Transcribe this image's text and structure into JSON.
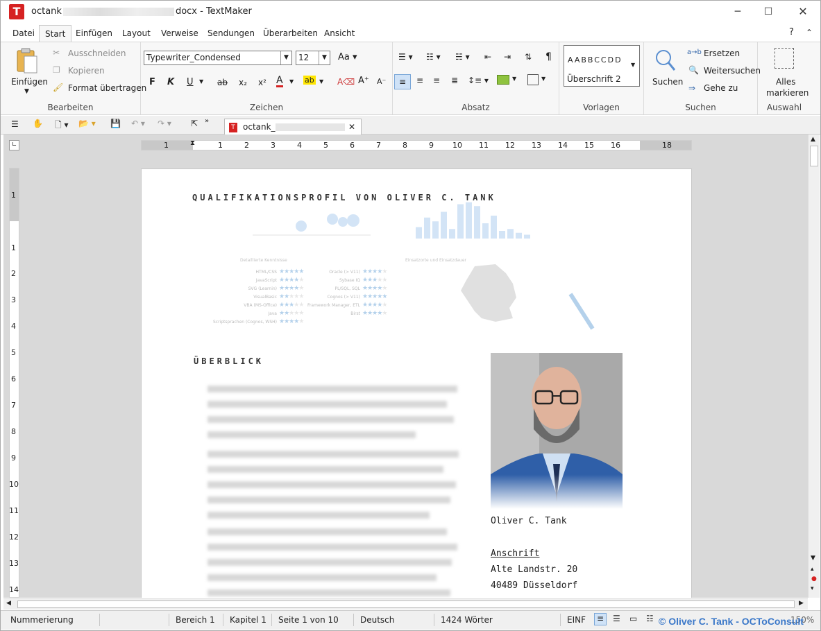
{
  "window": {
    "title_prefix": "octank",
    "title_suffix": "docx - TextMaker",
    "app_icon": "T",
    "minimize": "─",
    "maximize": "☐",
    "close": "✕"
  },
  "menu": [
    "Datei",
    "Start",
    "Einfügen",
    "Layout",
    "Verweise",
    "Sendungen",
    "Überarbeiten",
    "Ansicht"
  ],
  "menu_right": {
    "help": "?",
    "collapse": "⌃"
  },
  "ribbon": {
    "bearbeiten": {
      "paste": "Einfügen",
      "cut": "Ausschneiden",
      "copy": "Kopieren",
      "format_painter": "Format übertragen",
      "label": "Bearbeiten"
    },
    "zeichen": {
      "font": "Typewriter_Condensed",
      "size": "12",
      "bold": "F",
      "italic": "K",
      "underline": "U",
      "strike": "ab",
      "sub": "x₂",
      "sup": "x²",
      "label": "Zeichen"
    },
    "absatz": {
      "label": "Absatz",
      "pilcrow": "¶"
    },
    "vorlagen": {
      "preview": "AABBCCDD",
      "current": "Überschrift 2",
      "label": "Vorlagen"
    },
    "suchen": {
      "search": "Suchen",
      "replace": "Ersetzen",
      "find_next": "Weitersuchen",
      "goto": "Gehe zu",
      "label": "Suchen"
    },
    "auswahl": {
      "select_all_line1": "Alles",
      "select_all_line2": "markieren",
      "label": "Auswahl"
    }
  },
  "doc_tab": {
    "name": "octank_",
    "close": "✕"
  },
  "ruler": {
    "h_ticks": [
      "1",
      "1",
      "2",
      "3",
      "4",
      "5",
      "6",
      "7",
      "8",
      "9",
      "10",
      "11",
      "12",
      "13",
      "14",
      "15",
      "16",
      "18"
    ],
    "v_ticks": [
      "1",
      "1",
      "2",
      "3",
      "4",
      "5",
      "6",
      "7",
      "8",
      "9",
      "10",
      "11",
      "12",
      "13",
      "14"
    ]
  },
  "document": {
    "heading": "QUALIFIKATIONSPROFIL VON OLIVER C. TANK",
    "overview_heading": "ÜBERBLICK",
    "name": "Oliver C. Tank",
    "address_label": "Anschrift",
    "street": "Alte Landstr. 20",
    "city": "40489 Düsseldorf",
    "infographic": {
      "skills_title": "Detaillierte Kenntnisse",
      "map_title": "Einsatzorte und Einsatzdauer",
      "skills_left": [
        {
          "name": "HTML/CSS",
          "stars": 5
        },
        {
          "name": "JavaScript",
          "stars": 4
        },
        {
          "name": "SVG (Learnin)",
          "stars": 4
        },
        {
          "name": "VisualBasic",
          "stars": 2
        },
        {
          "name": "VBA (MS-Office)",
          "stars": 3
        },
        {
          "name": "Java",
          "stars": 2
        },
        {
          "name": "Scriptsprachen (Cognos, WSH)",
          "stars": 4
        }
      ],
      "skills_right": [
        {
          "name": "Oracle (> V11)",
          "stars": 4
        },
        {
          "name": "Sybase IQ",
          "stars": 3
        },
        {
          "name": "PL/SQL, SQL",
          "stars": 4
        },
        {
          "name": "Cognos (> V11)",
          "stars": 5
        },
        {
          "name": "Framework Manager, ETL",
          "stars": 4
        },
        {
          "name": "Birst",
          "stars": 4
        }
      ],
      "bar_heights": [
        0.3,
        0.55,
        0.45,
        0.7,
        0.25,
        0.9,
        0.95,
        0.85,
        0.4,
        0.6,
        0.2,
        0.25,
        0.15,
        0.1
      ]
    }
  },
  "status": {
    "numbering": "Nummerierung",
    "section": "Bereich 1",
    "chapter": "Kapitel 1",
    "page": "Seite 1 von 10",
    "language": "Deutsch",
    "words": "1424 Wörter",
    "mode": "EINF",
    "zoom": "150%"
  },
  "watermark": "© Oliver C. Tank - OCToConsult",
  "colors": {
    "accent": "#d62222",
    "star": "#5b9bd5",
    "watermark": "#3b78c9"
  }
}
